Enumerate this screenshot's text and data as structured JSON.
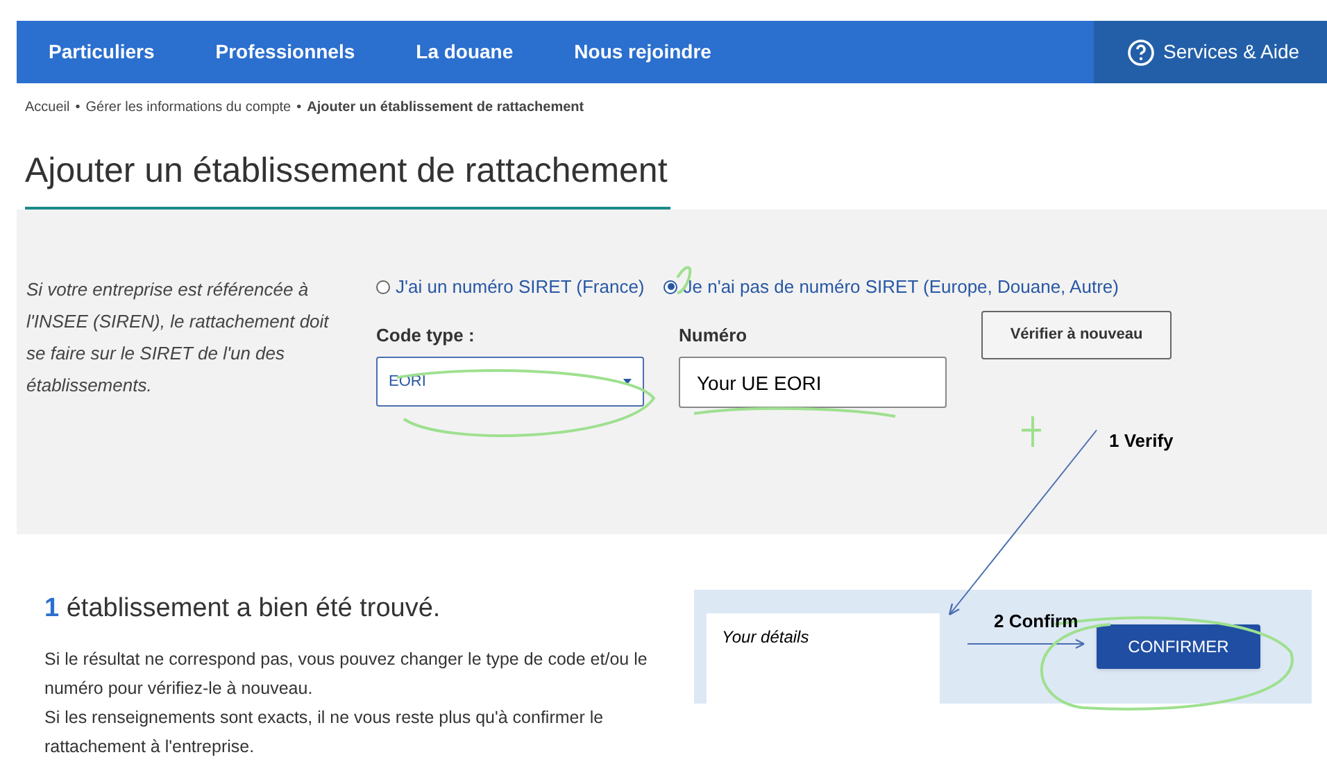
{
  "nav": {
    "items": [
      {
        "label": "Particuliers"
      },
      {
        "label": "Professionnels"
      },
      {
        "label": "La douane"
      },
      {
        "label": "Nous rejoindre"
      }
    ],
    "help": "Services & Aide"
  },
  "breadcrumb": {
    "items": [
      "Accueil",
      "Gérer les informations du compte"
    ],
    "current": "Ajouter un établissement de rattachement",
    "separator": "•"
  },
  "title": "Ajouter un établissement de rattachement",
  "form": {
    "hint": "Si votre entreprise est référencée à l'INSEE (SIREN), le rattachement doit se faire sur le SIRET de l'un des établissements.",
    "radios": [
      {
        "label": "J'ai un numéro SIRET (France)",
        "selected": false
      },
      {
        "label": "Je n'ai pas de numéro SIRET (Europe, Douane, Autre)",
        "selected": true
      }
    ],
    "code_type": {
      "label": "Code type :",
      "value": "EORI"
    },
    "numero": {
      "label": "Numéro",
      "value": "Your UE EORI"
    },
    "verify_button": "Vérifier à nouveau"
  },
  "result": {
    "count": "1",
    "heading": "établissement a bien été trouvé.",
    "text": "Si le résultat ne correspond pas, vous pouvez changer le type de code et/ou le numéro pour vérifiez-le à nouveau.\nSi les renseignements sont exacts, il ne vous reste plus qu'à confirmer le rattachement à l'entreprise.",
    "confirm_button": "CONFIRMER"
  },
  "annotations": [
    {
      "text": "1 Verify"
    },
    {
      "text": "2 Confirm"
    },
    {
      "text": "Your détails"
    }
  ]
}
